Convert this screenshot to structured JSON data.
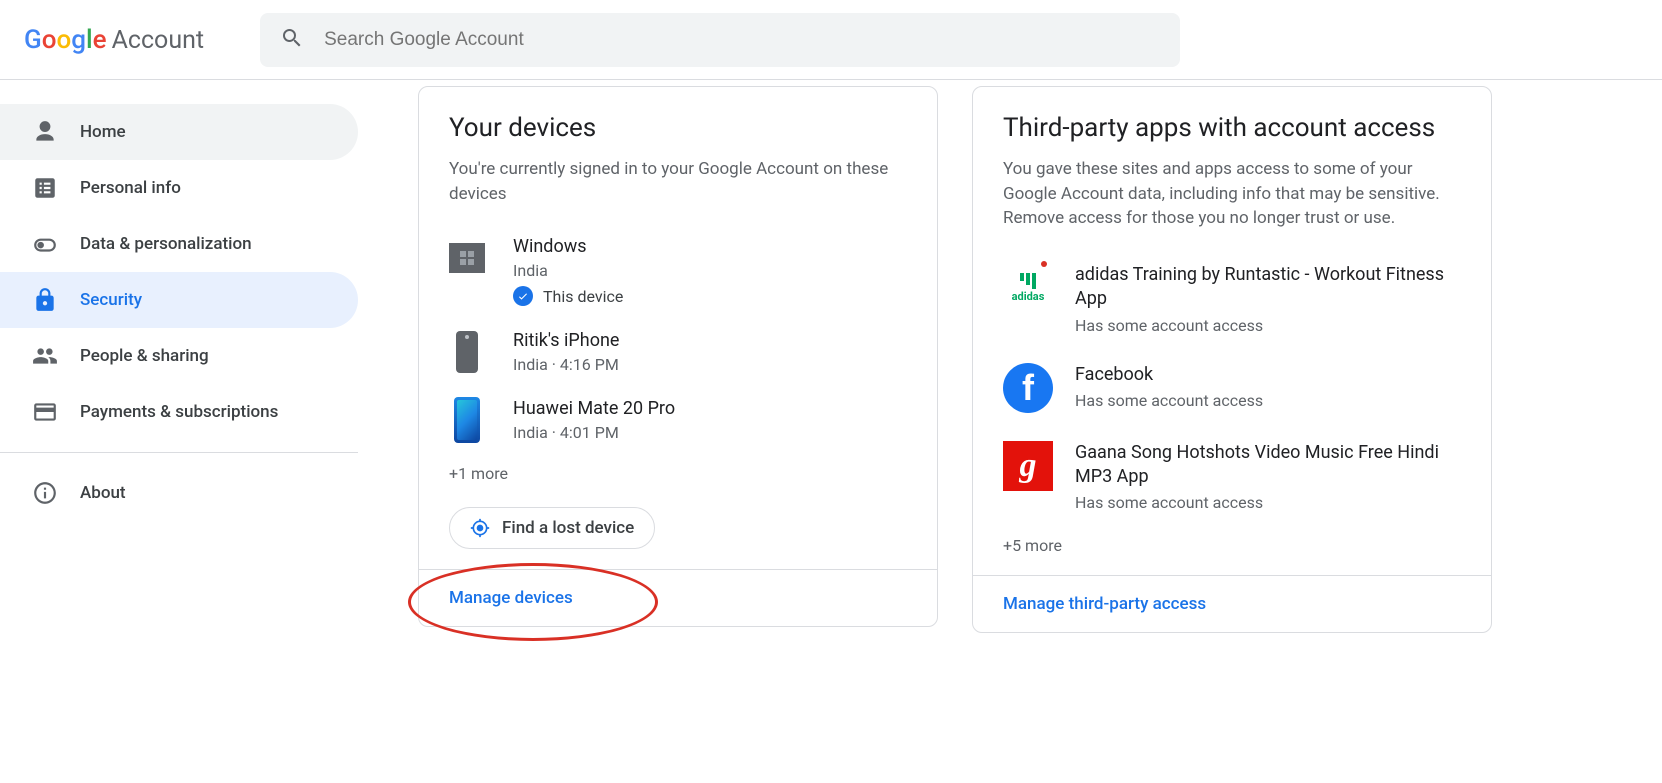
{
  "header": {
    "logo_account": "Account",
    "search_placeholder": "Search Google Account"
  },
  "sidebar": {
    "items": [
      {
        "label": "Home"
      },
      {
        "label": "Personal info"
      },
      {
        "label": "Data & personalization"
      },
      {
        "label": "Security"
      },
      {
        "label": "People & sharing"
      },
      {
        "label": "Payments & subscriptions"
      },
      {
        "label": "About"
      }
    ]
  },
  "devices_card": {
    "title": "Your devices",
    "description": "You're currently signed in to your Google Account on these devices",
    "devices": [
      {
        "name": "Windows",
        "sub": "India",
        "this_device": "This device"
      },
      {
        "name": "Ritik's iPhone",
        "sub": "India · 4:16 PM"
      },
      {
        "name": "Huawei Mate 20 Pro",
        "sub": "India · 4:01 PM"
      }
    ],
    "more": "+1 more",
    "find_lost": "Find a lost device",
    "manage": "Manage devices"
  },
  "apps_card": {
    "title": "Third-party apps with account access",
    "description": "You gave these sites and apps access to some of your Google Account data, including info that may be sensitive. Remove access for those you no longer trust or use.",
    "apps": [
      {
        "name": "adidas Training by Runtastic - Workout Fitness App",
        "sub": "Has some account access"
      },
      {
        "name": "Facebook",
        "sub": "Has some account access"
      },
      {
        "name": "Gaana Song Hotshots Video Music Free Hindi MP3 App",
        "sub": "Has some account access"
      }
    ],
    "more": "+5 more",
    "manage": "Manage third-party access"
  }
}
